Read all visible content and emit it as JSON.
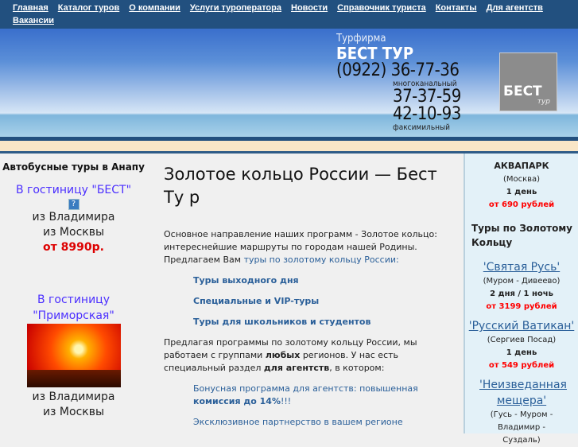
{
  "nav": [
    "Главная",
    "Каталог туров",
    "О компании",
    "Услуги туроператора",
    "Новости",
    "Справочник туриста",
    "Контакты",
    "Для агентств",
    "Вакансии"
  ],
  "header": {
    "subtitle": "Турфирма",
    "name": "БЕСТ ТУР",
    "code": "(0922)",
    "phone1": "36-77-36",
    "phone1_note": "многоканальный",
    "phone2": "37-37-59",
    "phone3": "42-10-93",
    "phone3_note": "факсимильный",
    "logo": "БЕСТ",
    "logo_sub": "тур"
  },
  "left": {
    "title": "Автобусные туры в Анапу",
    "hotel1": "В гостиницу \"БЕСТ\"",
    "broken_icon": "?",
    "from1": "из Владимира",
    "from2": "из Москвы",
    "price1": "от 8990р.",
    "hotel2": "В гостиницу \"Приморская\"",
    "from3": "из Владимира",
    "from4": "из Москвы"
  },
  "main": {
    "title": "Золотое кольцо России — Бест Ту р",
    "p1": "Основное направление наших программ - Золотое кольцо: интереснейшие маршруты по городам нашей Родины. Предлагаем Вам ",
    "p1_link": "туры по золотому кольцу России:",
    "links": [
      "Туры выходного дня",
      "Специальные и VIP-туры",
      "Туры для школьников и студентов"
    ],
    "p2a": "Предлагая программы по золотому кольцу России, мы работаем с группами ",
    "p2b": "любых",
    "p2c": " регионов. У нас есть специальный раздел ",
    "p2d": "для агентств",
    "p2e": ", в котором:",
    "a1": "Бонусная программа для агентств: повышенная ",
    "a1b": "комиссия до 14%",
    "a1c": "!!!",
    "a2": "Эксклюзивное партнерство в вашем регионе"
  },
  "right": {
    "aqua": "АКВАПАРК",
    "aqua_city": "(Москва)",
    "aqua_days": "1 день",
    "aqua_price": "от 690 рублей",
    "section": "Туры по Золотому Кольцу",
    "tours": [
      {
        "name": "'Святая Русь'",
        "route": "(Муром - Дивеево)",
        "days": "2 дня / 1 ночь",
        "price": "от 3199 рублей"
      },
      {
        "name": "'Русский Ватикан'",
        "route": "(Сергиев Посад)",
        "days": "1 день",
        "price": "от 549 рублей"
      },
      {
        "name": "'Неизведанная мещера'",
        "route": "(Гусь - Муром - Владимир - Суздаль)"
      }
    ]
  }
}
